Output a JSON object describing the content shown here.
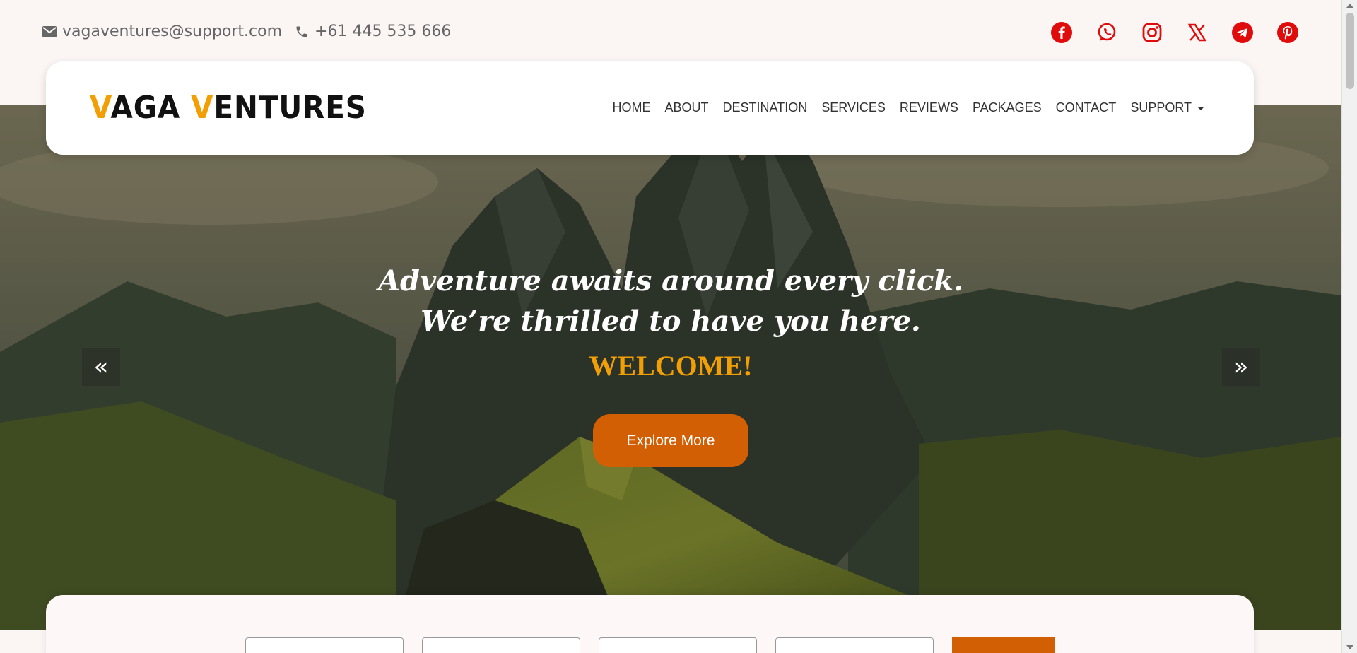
{
  "topbar": {
    "email": "vagaventures@support.com",
    "phone": "+61 445 535 666",
    "socials": [
      "facebook-icon",
      "whatsapp-icon",
      "instagram-icon",
      "x-icon",
      "telegram-icon",
      "pinterest-icon"
    ],
    "social_color": "#e00b0b"
  },
  "logo": {
    "first_initial": "V",
    "first_rest": "AGA ",
    "second_initial": "V",
    "second_rest": "ENTURES",
    "accent": "#f29f05"
  },
  "nav": {
    "items": [
      "HOME",
      "ABOUT",
      "DESTINATION",
      "SERVICES",
      "REVIEWS",
      "PACKAGES",
      "CONTACT",
      "SUPPORT"
    ]
  },
  "hero": {
    "line1": "Adventure awaits around every click.",
    "line2": "We’re thrilled to have you here.",
    "welcome": "WELCOME!",
    "cta": "Explore More",
    "prev": "«",
    "next": "»",
    "accent": "#d35f04"
  }
}
